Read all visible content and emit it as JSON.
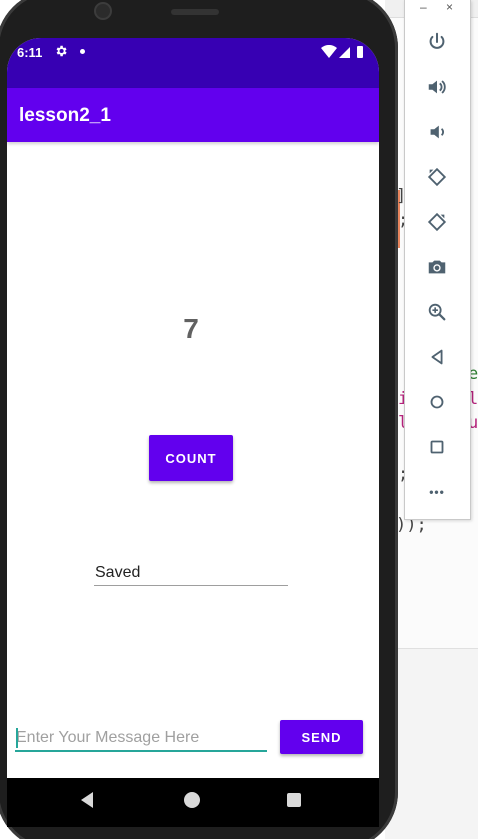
{
  "ide": {
    "code_fragments": [
      "]",
      ";",
      "e",
      "i",
      "l",
      "l",
      "u",
      ";",
      "));"
    ]
  },
  "status_bar": {
    "time": "6:11",
    "gear_icon": "gear-icon",
    "dot_icon": "notification-dot-icon",
    "wifi_icon": "wifi-icon",
    "signal_icon": "signal-icon",
    "battery_icon": "battery-icon"
  },
  "app": {
    "title": "lesson2_1",
    "counter_value": "7",
    "count_button_label": "COUNT",
    "saved_text": "Saved",
    "message_placeholder": "Enter Your Message Here",
    "message_value": "",
    "send_button_label": "SEND",
    "accent_color": "#6200ee",
    "status_bar_color": "#3700b3",
    "input_underline_color": "#26a69a"
  },
  "nav_bar": {
    "back_icon": "back-triangle-icon",
    "home_icon": "home-circle-icon",
    "recents_icon": "recents-square-icon"
  },
  "emulator_toolbar": {
    "minimize_label": "–",
    "close_label": "×",
    "tools": [
      {
        "name": "power-icon"
      },
      {
        "name": "volume-up-icon"
      },
      {
        "name": "volume-down-icon"
      },
      {
        "name": "rotate-left-icon"
      },
      {
        "name": "rotate-right-icon"
      },
      {
        "name": "camera-icon"
      },
      {
        "name": "zoom-icon"
      },
      {
        "name": "back-icon"
      },
      {
        "name": "home-icon"
      },
      {
        "name": "overview-icon"
      },
      {
        "name": "more-icon"
      }
    ],
    "more_label": "•••"
  }
}
